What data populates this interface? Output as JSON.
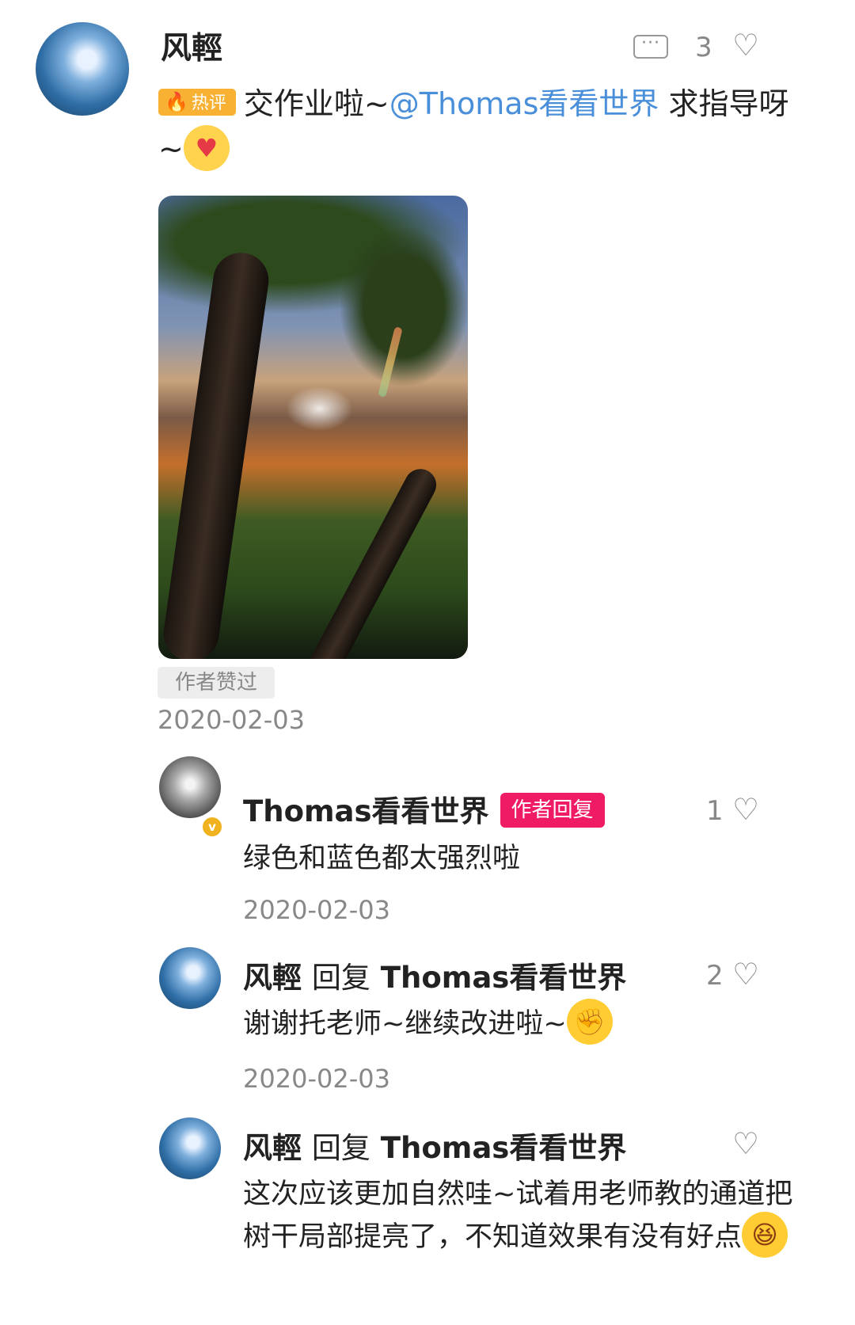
{
  "main_comment": {
    "author": "风輕",
    "more_icon": "···",
    "likes": "3",
    "hot_badge": "热评",
    "text_before": "交作业啦~",
    "mention": "@Thomas看看世界",
    "text_after": " 求指导呀~",
    "emoji": "love-emoji",
    "praise_tag": "作者赞过",
    "date": "2020-02-03"
  },
  "replies": [
    {
      "author": "Thomas看看世界",
      "author_tag": "作者回复",
      "likes": "1",
      "text": "绿色和蓝色都太强烈啦",
      "date": "2020-02-03"
    },
    {
      "author": "风輕",
      "reply_word": "回复",
      "reply_to": "Thomas看看世界",
      "likes": "2",
      "text": "谢谢托老师~继续改进啦~",
      "emoji": "fighting-emoji",
      "date": "2020-02-03"
    },
    {
      "author": "风輕",
      "reply_word": "回复",
      "reply_to": "Thomas看看世界",
      "likes": "",
      "text": "这次应该更加自然哇~试着用老师教的通道把树干局部提亮了，不知道效果有没有好点",
      "emoji": "laughing-emoji"
    }
  ],
  "colors": {
    "mention": "#4a8fd9",
    "author_tag_bg": "#ef1b64",
    "hot_badge_bg": "#f8b133"
  }
}
